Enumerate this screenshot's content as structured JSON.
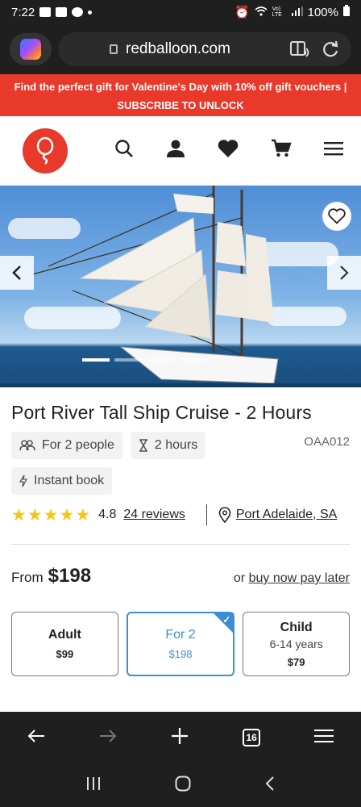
{
  "status": {
    "time": "7:22",
    "battery": "100%",
    "network": "Vo) LTE"
  },
  "browser": {
    "url": "redballoon.com",
    "tab_count": "16"
  },
  "promo": {
    "message": "Find the perfect gift for Valentine's Day with 10% off gift vouchers |",
    "cta": "SUBSCRIBE TO UNLOCK"
  },
  "header": {
    "icons": [
      "search-icon",
      "user-icon",
      "heart-icon",
      "cart-icon",
      "menu-icon"
    ]
  },
  "hero": {
    "slides": 4,
    "active_slide": 1
  },
  "product": {
    "title": "Port River Tall Ship Cruise - 2 Hours",
    "tags": {
      "people": "For 2 people",
      "duration": "2 hours",
      "booking": "Instant book"
    },
    "code": "OAA012",
    "rating": "4.8",
    "stars": 5,
    "reviews": "24 reviews",
    "location": "Port Adelaide, SA"
  },
  "pricing": {
    "from_label": "From",
    "price": "$198",
    "pay_prefix": "or",
    "pay_link": "buy now pay later"
  },
  "options": [
    {
      "label": "Adult",
      "sub": "",
      "price": "$99",
      "selected": false
    },
    {
      "label": "For 2",
      "sub": "",
      "price": "$198",
      "selected": true
    },
    {
      "label": "Child",
      "sub": "6-14 years",
      "price": "$79",
      "selected": false
    }
  ],
  "colors": {
    "brand_red": "#e8392b",
    "selected_blue": "#3a8fd3",
    "star_gold": "#f5c518"
  }
}
